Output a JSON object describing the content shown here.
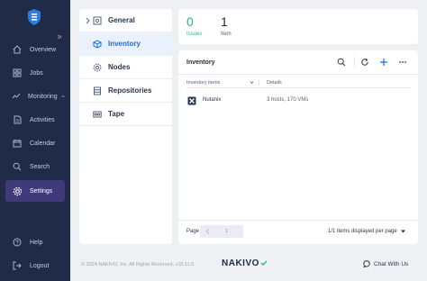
{
  "nav": {
    "overview": "Overview",
    "jobs": "Jobs",
    "monitoring": "Monitoring",
    "activities": "Activities",
    "calendar": "Calendar",
    "search": "Search",
    "settings": "Settings",
    "help": "Help",
    "logout": "Logout"
  },
  "settings_menu": {
    "general": "General",
    "inventory": "Inventory",
    "nodes": "Nodes",
    "repositories": "Repositories",
    "tape": "Tape"
  },
  "summary": {
    "issues_count": "0",
    "issues_label": "Issues",
    "items_count": "1",
    "items_label": "Item"
  },
  "inventory": {
    "title": "Inventory",
    "columns": [
      "Inventory items",
      "Details"
    ],
    "rows": [
      {
        "name": "Nutanix",
        "details": "3 hosts, 170 VMs",
        "icon": "nutanix-icon"
      }
    ],
    "pagination": {
      "page_label": "Page",
      "page_number": "1",
      "info": "1/1 items displayed per page"
    }
  },
  "footer": {
    "copyright": "© 2024 NAKIVO, Inc. All Rights Reserved. v10.11.0",
    "brand": "NAKIVO",
    "chat": "Chat With Us"
  },
  "colors": {
    "rail": "#1f2b47",
    "rail_active": "#3f3a7a",
    "accent": "#1c6fd6",
    "success": "#2fb389"
  }
}
